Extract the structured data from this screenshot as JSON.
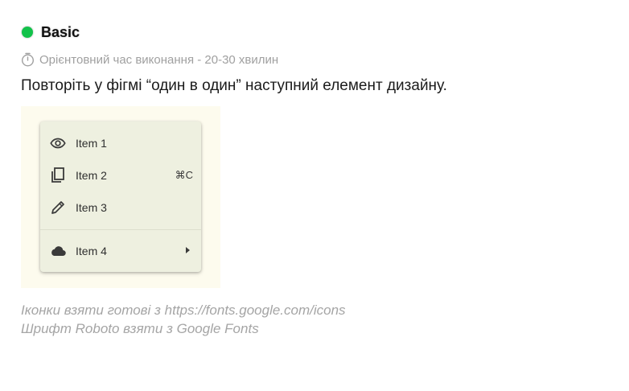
{
  "level": {
    "label": "Basic",
    "color": "#12c24a"
  },
  "time": {
    "icon": "stopwatch-icon",
    "text": "Орієнтовний час виконання - 20-30 хвилин"
  },
  "task": {
    "text": "Повторіть у фігмі “один в один” наступний елемент дизайну."
  },
  "preview": {
    "background": "#fdfbee",
    "menu_background": "#eef0e0",
    "items": [
      {
        "icon": "eye-icon",
        "label": "Item 1",
        "shortcut": ""
      },
      {
        "icon": "copy-icon",
        "label": "Item 2",
        "shortcut": "⌘C"
      },
      {
        "icon": "pencil-icon",
        "label": "Item 3",
        "shortcut": ""
      },
      {
        "icon": "cloud-icon",
        "label": "Item 4",
        "shortcut": "",
        "submenu": true
      }
    ]
  },
  "notes": {
    "line1": "Іконки взяти готові з https://fonts.google.com/icons",
    "line2": "Шрифт Roboto взяти з Google Fonts"
  }
}
